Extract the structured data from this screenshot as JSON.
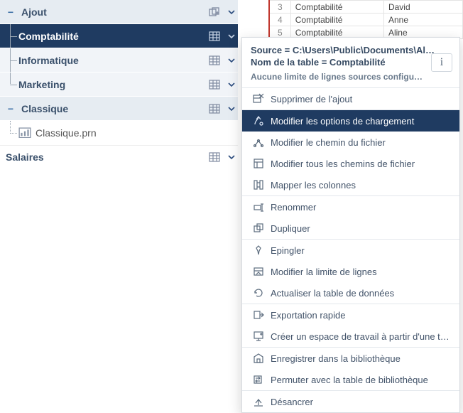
{
  "table": {
    "rows": [
      {
        "idx": "3",
        "col1": "Comptabilité",
        "col2": "David"
      },
      {
        "idx": "4",
        "col1": "Comptabilité",
        "col2": "Anne"
      },
      {
        "idx": "5",
        "col1": "Comptabilité",
        "col2": "Aline"
      }
    ]
  },
  "tree": {
    "groups": [
      {
        "label": "Ajout",
        "children": [
          {
            "label": "Comptabilité",
            "selected": true
          },
          {
            "label": "Informatique",
            "selected": false
          },
          {
            "label": "Marketing",
            "selected": false
          }
        ]
      },
      {
        "label": "Classique",
        "children": [
          {
            "label": "Classique.prn",
            "file": true
          }
        ]
      }
    ],
    "top": {
      "label": "Salaires"
    }
  },
  "ctx": {
    "source_label": "Source = C:\\Users\\Public\\Documents\\Al…",
    "table_label": "Nom de la table = Comptabilité",
    "limit_hint": "Aucune limite de lignes sources configu…",
    "items": [
      {
        "label": "Supprimer de l'ajout",
        "icon": "remove-from-append-icon"
      },
      {
        "sep": true
      },
      {
        "label": "Modifier les options de chargement",
        "icon": "load-options-icon",
        "selected": true
      },
      {
        "label": "Modifier le chemin du fichier",
        "icon": "edit-path-icon"
      },
      {
        "label": "Modifier tous les chemins de fichier",
        "icon": "edit-all-paths-icon"
      },
      {
        "label": "Mapper les colonnes",
        "icon": "map-columns-icon"
      },
      {
        "sep": true
      },
      {
        "label": "Renommer",
        "icon": "rename-icon"
      },
      {
        "label": "Dupliquer",
        "icon": "duplicate-icon"
      },
      {
        "sep": true
      },
      {
        "label": "Epingler",
        "icon": "pin-icon"
      },
      {
        "label": "Modifier la limite de lignes",
        "icon": "row-limit-icon"
      },
      {
        "label": "Actualiser la table de données",
        "icon": "refresh-icon"
      },
      {
        "sep": true
      },
      {
        "label": "Exportation rapide",
        "icon": "export-icon"
      },
      {
        "label": "Créer un espace de travail à partir d'une table",
        "icon": "create-workspace-icon"
      },
      {
        "sep": true
      },
      {
        "label": "Enregistrer dans la bibliothèque",
        "icon": "save-library-icon"
      },
      {
        "label": "Permuter avec la table de bibliothèque",
        "icon": "swap-library-icon"
      },
      {
        "sep": true
      },
      {
        "label": "Désancrer",
        "icon": "undock-icon"
      }
    ]
  }
}
